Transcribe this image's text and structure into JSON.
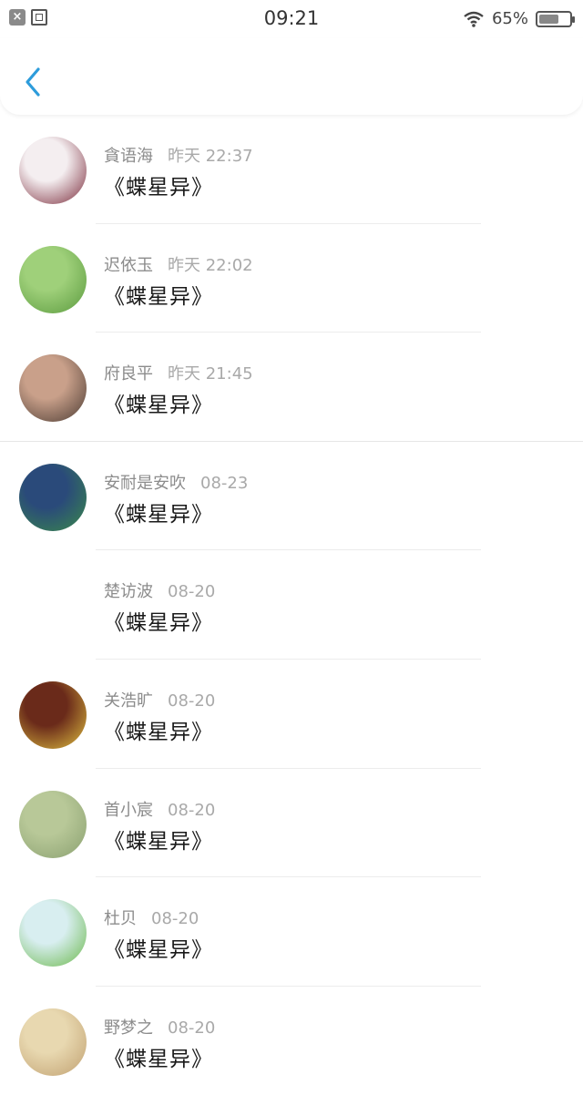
{
  "status_bar": {
    "time": "09:21",
    "battery_percent": "65%",
    "battery_level": 0.65
  },
  "nav": {
    "back_icon": "chevron-left-icon",
    "accent": "#2d9cdb"
  },
  "items": [
    {
      "name": "貪语海",
      "time": "昨天 22:37",
      "title": "《蝶星异》",
      "avatar_colors": [
        "#f4eef0",
        "#7a2a3a"
      ]
    },
    {
      "name": "迟依玉",
      "time": "昨天 22:02",
      "title": "《蝶星异》",
      "avatar_colors": [
        "#9fd07a",
        "#5a9a3e"
      ]
    },
    {
      "name": "府良平",
      "time": "昨天 21:45",
      "title": "《蝶星异》",
      "avatar_colors": [
        "#c9a08a",
        "#4a3a32"
      ]
    },
    {
      "name": "安耐是安吹",
      "time": "08-23",
      "title": "《蝶星异》",
      "avatar_colors": [
        "#2a4a7a",
        "#3a8a4a"
      ]
    },
    {
      "name": "楚访波",
      "time": "08-20",
      "title": "《蝶星异》",
      "avatar_colors": []
    },
    {
      "name": "关浩旷",
      "time": "08-20",
      "title": "《蝶星异》",
      "avatar_colors": [
        "#6a2a1a",
        "#e0c040"
      ]
    },
    {
      "name": "首小宸",
      "time": "08-20",
      "title": "《蝶星异》",
      "avatar_colors": [
        "#b8c898",
        "#8aa070"
      ]
    },
    {
      "name": "杜贝",
      "time": "08-20",
      "title": "《蝶星异》",
      "avatar_colors": [
        "#d8eef0",
        "#6ab84a"
      ]
    },
    {
      "name": "野梦之",
      "time": "08-20",
      "title": "《蝶星异》",
      "avatar_colors": [
        "#e8d8b0",
        "#c0a070"
      ]
    }
  ]
}
